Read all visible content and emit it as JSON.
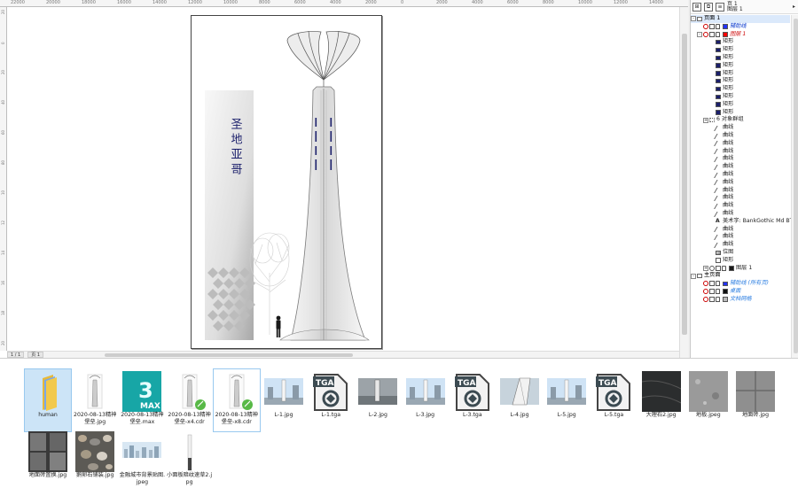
{
  "ruler": {
    "h_ticks": [
      "22000",
      "20000",
      "18000",
      "16000",
      "14000",
      "12000",
      "10000",
      "8000",
      "6000",
      "4000",
      "2000",
      "0",
      "2000",
      "4000",
      "6000",
      "8000",
      "10000",
      "12000",
      "14000"
    ],
    "v_ticks": [
      "2000",
      "0",
      "2000",
      "4000",
      "6000",
      "8000",
      "10000",
      "12000",
      "14000",
      "16000",
      "18000",
      "20000"
    ]
  },
  "page_tabs": [
    "1 / 1",
    "页 1"
  ],
  "artwork": {
    "vertical_text": "圣地亚哥",
    "colors": {
      "accent": "#1b1f6b",
      "tower": "#e6e6e6"
    }
  },
  "panel": {
    "header_text_1": "页 1",
    "header_text_2": "图层 1",
    "rows": [
      {
        "label": "页面 1",
        "indent": 1,
        "type": "page",
        "expand": "-"
      },
      {
        "label": "辅助线",
        "indent": 2,
        "type": "layer",
        "color": "#0033cc",
        "italic": true,
        "swatch": "#2233ff"
      },
      {
        "label": "图层 1",
        "indent": 2,
        "type": "layer",
        "color": "#cc0000",
        "italic": true,
        "swatch": "#ff0000",
        "expand": "-"
      },
      {
        "label": "矩形",
        "indent": 4,
        "type": "obj",
        "swatch": "#1b1f6b"
      },
      {
        "label": "矩形",
        "indent": 4,
        "type": "obj",
        "swatch": "#1b1f6b"
      },
      {
        "label": "矩形",
        "indent": 4,
        "type": "obj",
        "swatch": "#1b1f6b"
      },
      {
        "label": "矩形",
        "indent": 4,
        "type": "obj",
        "swatch": "#1b1f6b"
      },
      {
        "label": "矩形",
        "indent": 4,
        "type": "obj",
        "swatch": "#1b1f6b"
      },
      {
        "label": "矩形",
        "indent": 4,
        "type": "obj",
        "swatch": "#1b1f6b"
      },
      {
        "label": "矩形",
        "indent": 4,
        "type": "obj",
        "swatch": "#1b1f6b"
      },
      {
        "label": "矩形",
        "indent": 4,
        "type": "obj",
        "swatch": "#1b1f6b"
      },
      {
        "label": "矩形",
        "indent": 4,
        "type": "obj",
        "swatch": "#1b1f6b"
      },
      {
        "label": "矩形",
        "indent": 4,
        "type": "obj",
        "swatch": "#1b1f6b"
      },
      {
        "label": "6 对象群组",
        "indent": 3,
        "type": "group",
        "expand": "+"
      },
      {
        "label": "曲线",
        "indent": 4,
        "type": "curve"
      },
      {
        "label": "曲线",
        "indent": 4,
        "type": "curve"
      },
      {
        "label": "曲线",
        "indent": 4,
        "type": "curve"
      },
      {
        "label": "曲线",
        "indent": 4,
        "type": "curve"
      },
      {
        "label": "曲线",
        "indent": 4,
        "type": "curve"
      },
      {
        "label": "曲线",
        "indent": 4,
        "type": "curve"
      },
      {
        "label": "曲线",
        "indent": 4,
        "type": "curve"
      },
      {
        "label": "曲线",
        "indent": 4,
        "type": "curve"
      },
      {
        "label": "曲线",
        "indent": 4,
        "type": "curve"
      },
      {
        "label": "曲线",
        "indent": 4,
        "type": "curve"
      },
      {
        "label": "曲线",
        "indent": 4,
        "type": "curve"
      },
      {
        "label": "曲线",
        "indent": 4,
        "type": "curve"
      },
      {
        "label": "美术字: BankGothic Md BT (常",
        "indent": 4,
        "type": "text"
      },
      {
        "label": "曲线",
        "indent": 4,
        "type": "curve"
      },
      {
        "label": "曲线",
        "indent": 4,
        "type": "curve"
      },
      {
        "label": "曲线",
        "indent": 4,
        "type": "curve"
      },
      {
        "label": "位图",
        "indent": 4,
        "type": "bitmap"
      },
      {
        "label": "矩形",
        "indent": 4,
        "type": "rect"
      },
      {
        "label": "图层 1",
        "indent": 3,
        "type": "layer",
        "color": "#222222",
        "swatch": "#1a1a1a",
        "expand": "+"
      },
      {
        "label": "主页面",
        "indent": 1,
        "type": "page",
        "expand": "-"
      },
      {
        "label": "辅助线 (所有页)",
        "indent": 2,
        "type": "layer",
        "color": "#2a7de1",
        "italic": true,
        "swatch": "#2233ff"
      },
      {
        "label": "桌面",
        "indent": 2,
        "type": "layer",
        "color": "#2a7de1",
        "italic": true,
        "swatch": "#111111"
      },
      {
        "label": "文档网格",
        "indent": 2,
        "type": "layer",
        "color": "#2a7de1",
        "italic": true,
        "swatch": "#bbbbbb"
      }
    ]
  },
  "files": [
    {
      "name": "human",
      "kind": "folder",
      "selected": true
    },
    {
      "name": "2020-08-13精神堡垒.jpg",
      "kind": "jpg-tower"
    },
    {
      "name": "2020-08-13精神堡垒.max",
      "kind": "max"
    },
    {
      "name": "2020-08-13精神堡垒-x4.cdr",
      "kind": "cdr"
    },
    {
      "name": "2020-08-13精神堡垒-x8.cdr",
      "kind": "cdr",
      "outlined": true
    },
    {
      "name": "L-1.jpg",
      "kind": "render"
    },
    {
      "name": "L-1.tga",
      "kind": "tga"
    },
    {
      "name": "L-2.jpg",
      "kind": "render-dark"
    },
    {
      "name": "L-3.jpg",
      "kind": "render"
    },
    {
      "name": "L-3.tga",
      "kind": "tga"
    },
    {
      "name": "L-4.jpg",
      "kind": "render-close"
    },
    {
      "name": "L-5.jpg",
      "kind": "render"
    },
    {
      "name": "L-5.tga",
      "kind": "tga"
    },
    {
      "name": "大理石2.jpg",
      "kind": "marble"
    },
    {
      "name": "地板.jpeg",
      "kind": "stone"
    },
    {
      "name": "地面砖.jpg",
      "kind": "tile"
    },
    {
      "name": "地面砖置换.jpg",
      "kind": "tile-dark"
    },
    {
      "name": "鹅卵石铺装.jpg",
      "kind": "pebble"
    },
    {
      "name": "金融城市背景贴图.jpeg",
      "kind": "city"
    },
    {
      "name": "小面板暗纹速草2.jpg",
      "kind": "strip"
    }
  ]
}
